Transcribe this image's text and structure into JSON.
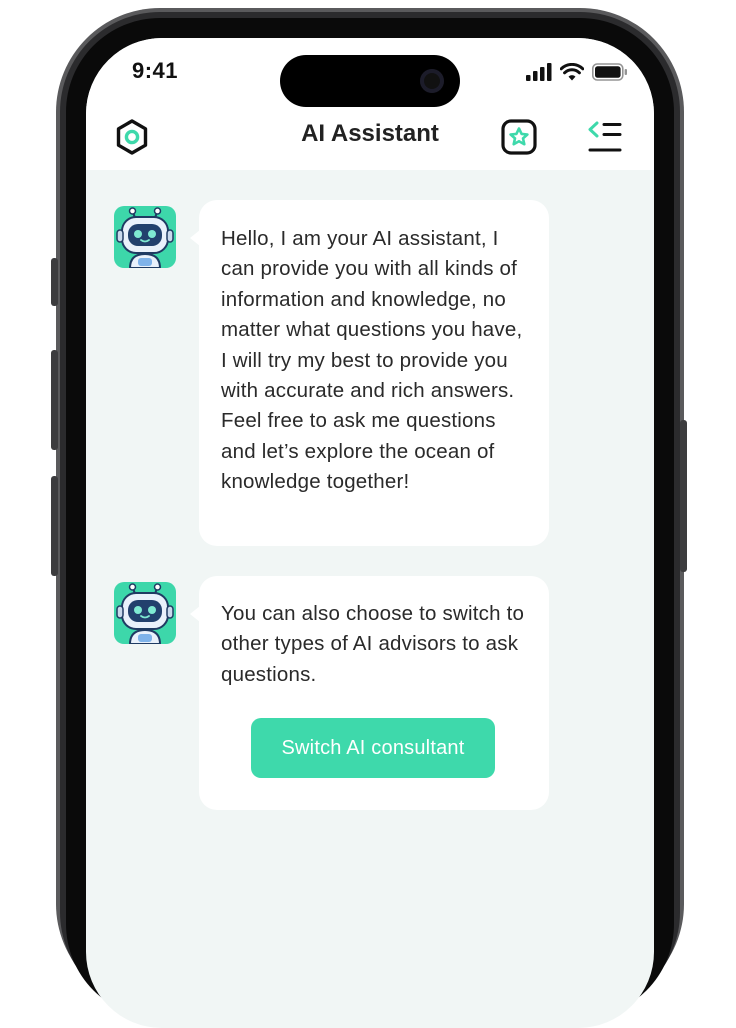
{
  "status_bar": {
    "time": "9:41"
  },
  "header": {
    "title": "AI Assistant",
    "icons": [
      "settings-hexagon-icon",
      "favorite-star-icon",
      "menu-list-icon"
    ]
  },
  "messages": [
    {
      "sender": "ai",
      "text": "Hello, I am your AI assistant, I can provide you with all kinds of information and knowledge, no matter what questions you have, I will try my best to provide you with accurate and rich answers. Feel free to ask me questions and let’s explore the ocean of knowledge together!"
    },
    {
      "sender": "ai",
      "text": "You can also choose to switch to other types of AI advisors to ask questions.",
      "button_label": "Switch AI consultant"
    }
  ],
  "colors": {
    "accent": "#3ed9ab",
    "chat_background": "#f1f6f5",
    "bubble": "#ffffff",
    "text": "#2a2a2a"
  }
}
